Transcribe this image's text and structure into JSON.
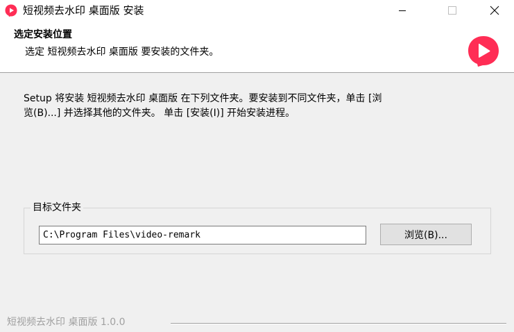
{
  "window": {
    "title": "短视频去水印 桌面版 安装",
    "icon": "app-logo-icon",
    "controls": {
      "minimize": "minimize-icon",
      "maximize": "maximize-icon",
      "close": "close-icon"
    }
  },
  "header": {
    "title": "选定安装位置",
    "subtitle": "选定 短视频去水印 桌面版 要安装的文件夹。",
    "logo": "app-logo-icon"
  },
  "body": {
    "description": "Setup 将安装 短视频去水印 桌面版 在下列文件夹。要安装到不同文件夹，单击 [浏\n览(B)...] 并选择其他的文件夹。 单击 [安装(I)] 开始安装进程。"
  },
  "destination": {
    "group_label": "目标文件夹",
    "path_value": "C:\\Program Files\\video-remark",
    "browse_label": "浏览(B)..."
  },
  "footer": {
    "brand_text": "短视频去水印 桌面版 1.0.0"
  },
  "colors": {
    "brand": "#ff2d55",
    "window_bg": "#f0f0f0",
    "header_bg": "#ffffff",
    "disabled_text": "#a0a0a0"
  }
}
